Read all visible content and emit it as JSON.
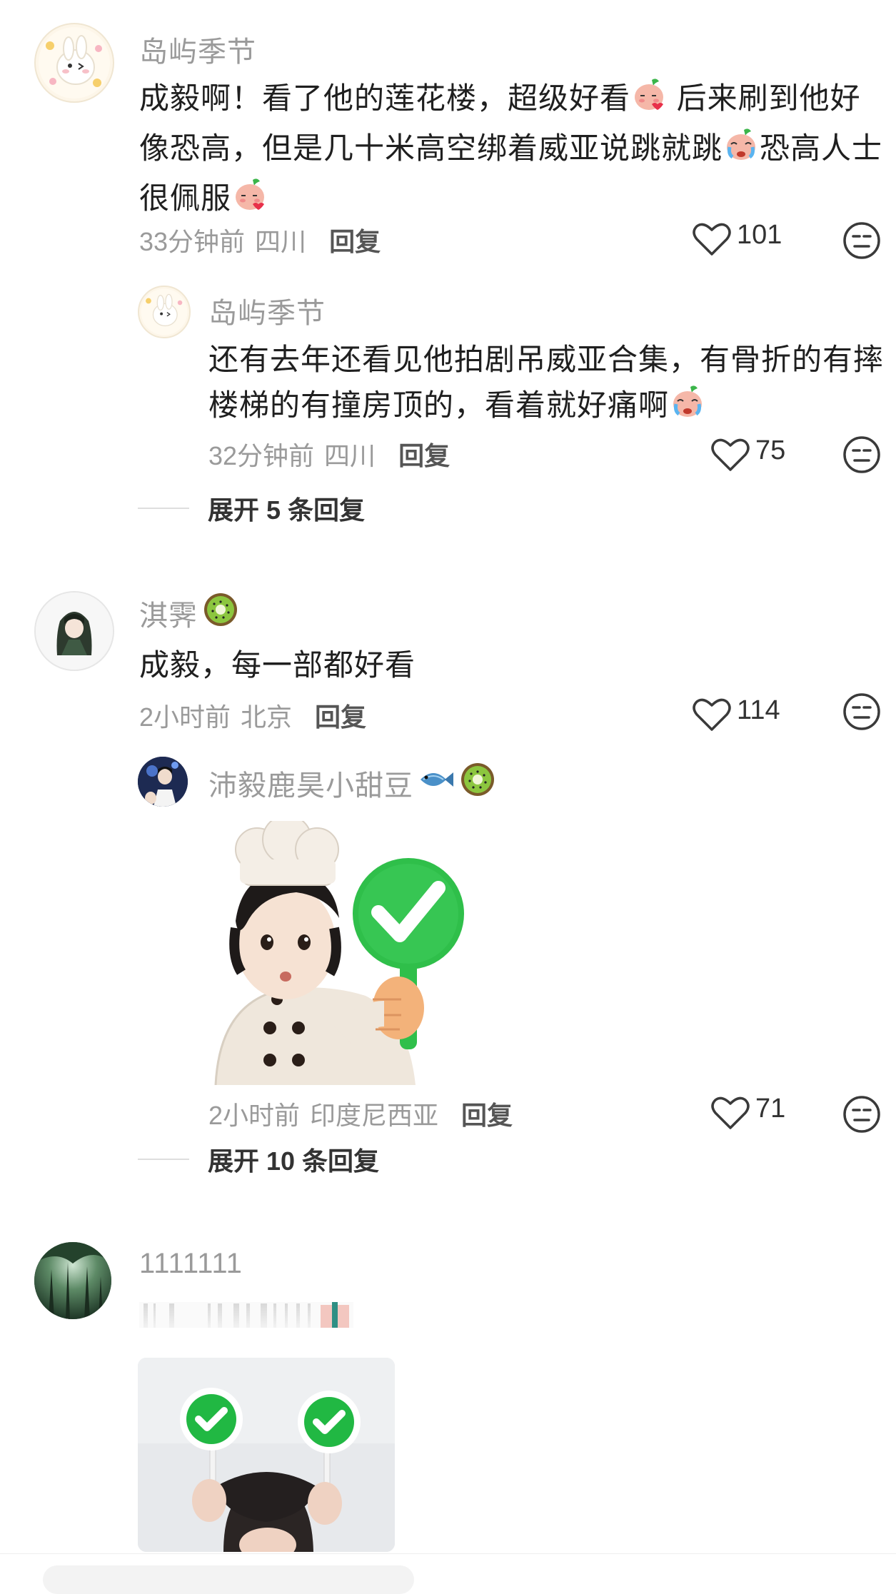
{
  "comments": [
    {
      "username": "岛屿季节",
      "text_line1": "成毅啊！看了他的莲花楼，超级好看",
      "text_line1b": " 后来刷到他好",
      "text_line2": "像恐高，但是几十米高空绑着威亚说跳就跳",
      "text_line2b": "恐高人士",
      "text_line3": "很佩服",
      "time": "33分钟前",
      "location": "四川",
      "reply_label": "回复",
      "likes": "101",
      "reply": {
        "username": "岛屿季节",
        "text_line1": "还有去年还看见他拍剧吊威亚合集，有骨折的有摔",
        "text_line2": "楼梯的有撞房顶的，看着就好痛啊",
        "time": "32分钟前",
        "location": "四川",
        "reply_label": "回复",
        "likes": "75"
      },
      "expand_label": "展开 5 条回复"
    },
    {
      "username": "淇霁",
      "text": "成毅，每一部都好看",
      "time": "2小时前",
      "location": "北京",
      "reply_label": "回复",
      "likes": "114",
      "reply": {
        "username": "沛毅鹿昊小甜豆",
        "time": "2小时前",
        "location": "印度尼西亚",
        "reply_label": "回复",
        "likes": "71"
      },
      "expand_label": "展开 10 条回复"
    },
    {
      "username": "1111111"
    }
  ],
  "icons": {
    "like": "heart-outline-icon",
    "emoji": "neutral-face-icon",
    "kiwi": "kiwi-emoji",
    "fish": "fish-emoji",
    "peach_kiss": "peach-kiss-emoji",
    "peach_cry": "peach-cry-emoji"
  },
  "colors": {
    "username": "#9a9a9a",
    "text": "#1f1f1f",
    "meta": "#9a9a9a",
    "sign_green": "#2fbf4a"
  }
}
